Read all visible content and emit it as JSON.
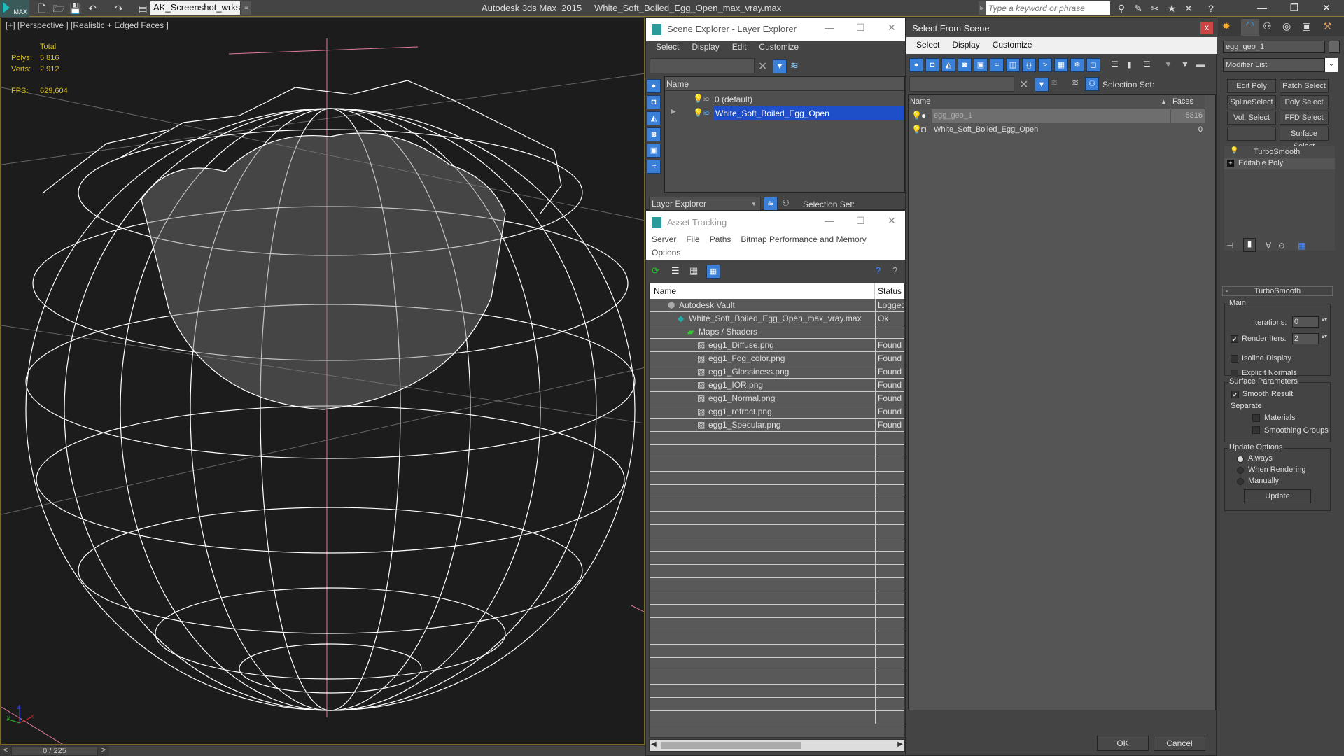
{
  "app": {
    "title": "Autodesk 3ds Max  2015     White_Soft_Boiled_Egg_Open_max_vray.max",
    "workspace": "AK_Screenshot_wrksp",
    "search_placeholder": "Type a keyword or phrase",
    "logo_label": "MAX"
  },
  "viewport": {
    "label": "[+] [Perspective ] [Realistic + Edged Faces ]",
    "stats": {
      "header": "Total",
      "polys_label": "Polys:",
      "polys_value": "5 816",
      "verts_label": "Verts:",
      "verts_value": "2 912",
      "fps_label": "FPS:",
      "fps_value": "629,604"
    },
    "axis": {
      "x": "x",
      "y": "y",
      "z": "z"
    }
  },
  "timeline": {
    "frame": "0 / 225",
    "prev": "<",
    "next": ">"
  },
  "scene_explorer": {
    "title": "Scene Explorer - Layer Explorer",
    "menu": [
      "Select",
      "Display",
      "Edit",
      "Customize"
    ],
    "column": "Name",
    "rows": [
      {
        "name": "0 (default)",
        "selected": false
      },
      {
        "name": "White_Soft_Boiled_Egg_Open",
        "selected": true
      }
    ],
    "footer_dropdown": "Layer Explorer",
    "selection_set_label": "Selection Set:"
  },
  "asset_tracking": {
    "title": "Asset Tracking",
    "menu": [
      "Server",
      "File",
      "Paths",
      "Bitmap Performance and Memory",
      "Options"
    ],
    "columns": [
      "Name",
      "Status"
    ],
    "rows": [
      {
        "name": "Autodesk Vault",
        "status": "Logged",
        "indent": 1,
        "icon": "vault-icon"
      },
      {
        "name": "White_Soft_Boiled_Egg_Open_max_vray.max",
        "status": "Ok",
        "indent": 2,
        "icon": "max-file-icon"
      },
      {
        "name": "Maps / Shaders",
        "status": "",
        "indent": 3,
        "icon": "maps-icon"
      },
      {
        "name": "egg1_Diffuse.png",
        "status": "Found",
        "indent": 4,
        "icon": "bitmap-icon"
      },
      {
        "name": "egg1_Fog_color.png",
        "status": "Found",
        "indent": 4,
        "icon": "bitmap-icon"
      },
      {
        "name": "egg1_Glossiness.png",
        "status": "Found",
        "indent": 4,
        "icon": "bitmap-icon"
      },
      {
        "name": "egg1_IOR.png",
        "status": "Found",
        "indent": 4,
        "icon": "bitmap-icon"
      },
      {
        "name": "egg1_Normal.png",
        "status": "Found",
        "indent": 4,
        "icon": "bitmap-icon"
      },
      {
        "name": "egg1_refract.png",
        "status": "Found",
        "indent": 4,
        "icon": "bitmap-icon"
      },
      {
        "name": "egg1_Specular.png",
        "status": "Found",
        "indent": 4,
        "icon": "bitmap-icon"
      }
    ]
  },
  "select_from_scene": {
    "title": "Select From Scene",
    "close": "x",
    "menu": [
      "Select",
      "Display",
      "Customize"
    ],
    "selection_set_label": "Selection Set:",
    "columns": [
      "Name",
      "Faces"
    ],
    "rows": [
      {
        "name": "egg_geo_1",
        "faces": "5816",
        "selected": true
      },
      {
        "name": "White_Soft_Boiled_Egg_Open",
        "faces": "0",
        "selected": false
      }
    ],
    "ok": "OK",
    "cancel": "Cancel"
  },
  "command_panel": {
    "object_name": "egg_geo_1",
    "modifier_list": "Modifier List",
    "buttons": [
      "Edit Poly",
      "Patch Select",
      "SplineSelect",
      "Poly Select",
      "Vol. Select",
      "FFD Select",
      "",
      "Surface Select"
    ],
    "stack": [
      "TurboSmooth",
      "Editable Poly"
    ],
    "rollout_title": "TurboSmooth",
    "main_group": "Main",
    "iterations_label": "Iterations:",
    "iterations_value": "0",
    "render_iters_label": "Render Iters:",
    "render_iters_value": "2",
    "render_iters_checked": true,
    "isoline_label": "Isoline Display",
    "isoline_checked": false,
    "explicit_normals_label": "Explicit Normals",
    "explicit_normals_checked": false,
    "surface_group": "Surface Parameters",
    "smooth_result_label": "Smooth Result",
    "smooth_result_checked": true,
    "separate_label": "Separate",
    "materials_label": "Materials",
    "smoothing_groups_label": "Smoothing Groups",
    "update_group": "Update Options",
    "update_options": [
      "Always",
      "When Rendering",
      "Manually"
    ],
    "update_selected": "Always",
    "update_button": "Update"
  }
}
